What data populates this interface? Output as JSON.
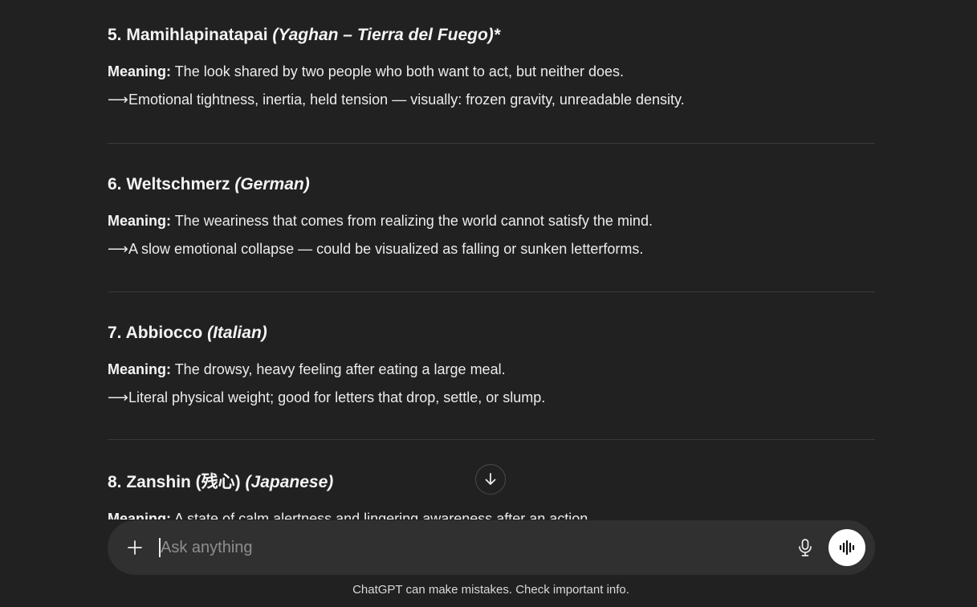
{
  "entries": [
    {
      "number_name": "5. Mamihlapinatapai",
      "language": "(Yaghan – Tierra del Fuego)*",
      "meaning_label": "Meaning:",
      "meaning_text": "The look shared by two people who both want to act, but neither does.",
      "arrow": "⟶",
      "note": "Emotional tightness, inertia, held tension — visually: frozen gravity, unreadable density."
    },
    {
      "number_name": "6. Weltschmerz",
      "language": "(German)",
      "meaning_label": "Meaning:",
      "meaning_text": "The weariness that comes from realizing the world cannot satisfy the mind.",
      "arrow": "⟶",
      "note": "A slow emotional collapse — could be visualized as falling or sunken letterforms."
    },
    {
      "number_name": "7. Abbiocco",
      "language": "(Italian)",
      "meaning_label": "Meaning:",
      "meaning_text": "The drowsy, heavy feeling after eating a large meal.",
      "arrow": "⟶",
      "note": "Literal physical weight; good for letters that drop, settle, or slump."
    },
    {
      "number_name": "8. Zanshin (残心)",
      "language": "(Japanese)",
      "meaning_label": "Meaning:",
      "meaning_text": "A state of calm alertness and lingering awareness after an action."
    }
  ],
  "composer": {
    "placeholder": "Ask anything",
    "plus_icon": "plus-icon",
    "mic_icon": "microphone-icon",
    "voice_icon": "voice-mode-icon"
  },
  "scroll_icon": "arrow-down-icon",
  "disclaimer": "ChatGPT can make mistakes. Check important info.",
  "colors": {
    "background": "#212121",
    "composer": "#303030",
    "text": "#ececec",
    "placeholder": "#8e8e8e",
    "voice_button": "#ffffff"
  }
}
